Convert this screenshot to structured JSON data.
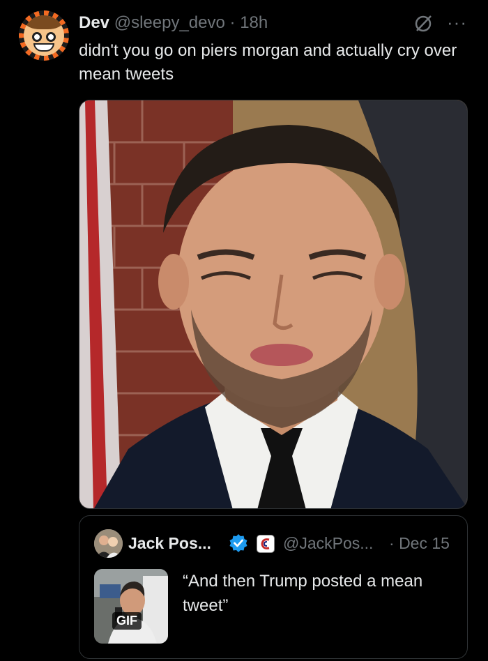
{
  "tweet": {
    "name": "Dev",
    "handle": "@sleepy_devo",
    "separator": "·",
    "time": "18h",
    "text": "didn't you go on piers morgan and actually cry over mean tweets",
    "icons": {
      "avatar": "cartoon-avatar",
      "grok": "grok-icon",
      "more": "more-icon"
    }
  },
  "media": {
    "type": "photo",
    "subject": "portrait"
  },
  "quote": {
    "name": "Jack Pos...",
    "handle": "@JackPos...",
    "separator": "·",
    "date": "Dec 15",
    "text": "“And then Trump posted a mean tweet”",
    "gif_label": "GIF",
    "colors": {
      "verified": "#1d9bf0"
    }
  }
}
